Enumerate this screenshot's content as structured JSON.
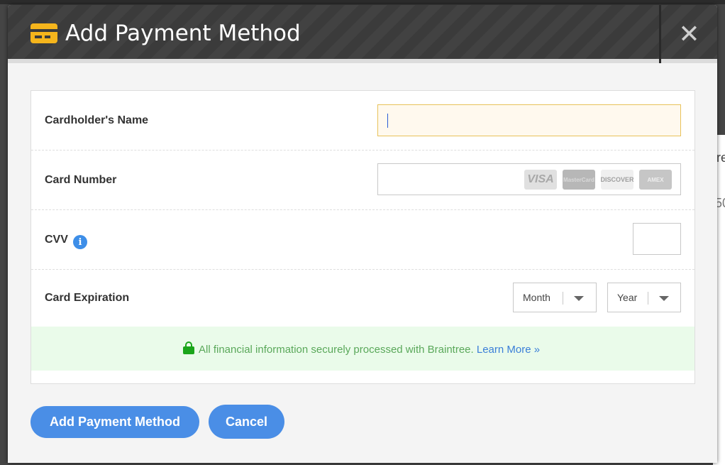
{
  "modal": {
    "title": "Add Payment Method",
    "close_symbol": "✕",
    "icon": "credit-card-icon",
    "accent_color": "#f5b51c"
  },
  "background": {
    "text1": "re",
    "text2": "50"
  },
  "form": {
    "cardholder_name": {
      "label": "Cardholder's Name",
      "value": ""
    },
    "card_number": {
      "label": "Card Number",
      "value": "",
      "logos": [
        "VISA",
        "MasterCard",
        "DISCOVER",
        "AMEX"
      ]
    },
    "cvv": {
      "label": "CVV",
      "info_symbol": "i",
      "value": ""
    },
    "expiration": {
      "label": "Card Expiration",
      "month_label": "Month",
      "year_label": "Year"
    }
  },
  "secure_notice": {
    "text": "All financial information securely processed with Braintree.",
    "link": "Learn More »"
  },
  "buttons": {
    "submit_label": "Add Payment Method",
    "cancel_label": "Cancel",
    "color": "#4a8ee6"
  }
}
